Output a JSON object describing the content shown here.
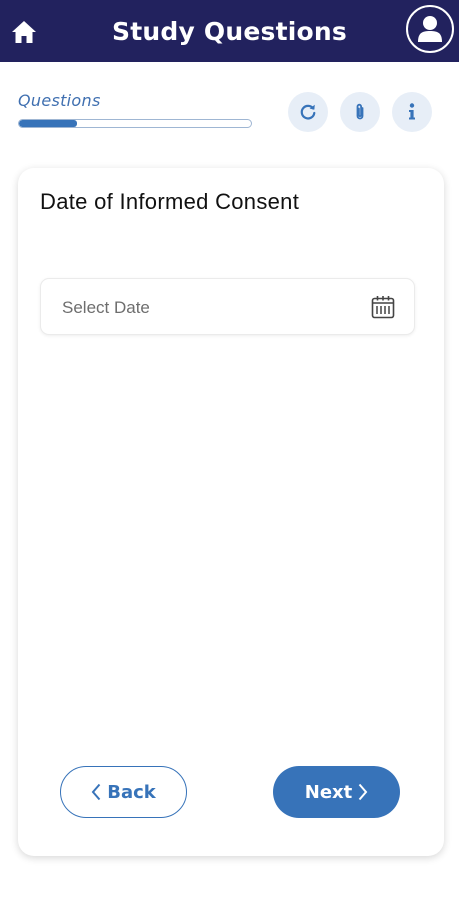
{
  "header": {
    "title": "Study Questions",
    "background": "#22225e",
    "icons": {
      "home": "home-icon",
      "profile": "user-icon"
    }
  },
  "progress": {
    "label": "Questions",
    "value_fraction": 0.25,
    "color": "#3773b9"
  },
  "toolbar": {
    "icons": [
      "refresh-icon",
      "paperclip-icon",
      "info-icon"
    ]
  },
  "question": {
    "text": "Date of Informed Consent",
    "date_placeholder": "Select Date",
    "date_icon": "calendar-icon"
  },
  "nav": {
    "back_label": "Back",
    "next_label": "Next",
    "accent": "#3773b9"
  }
}
